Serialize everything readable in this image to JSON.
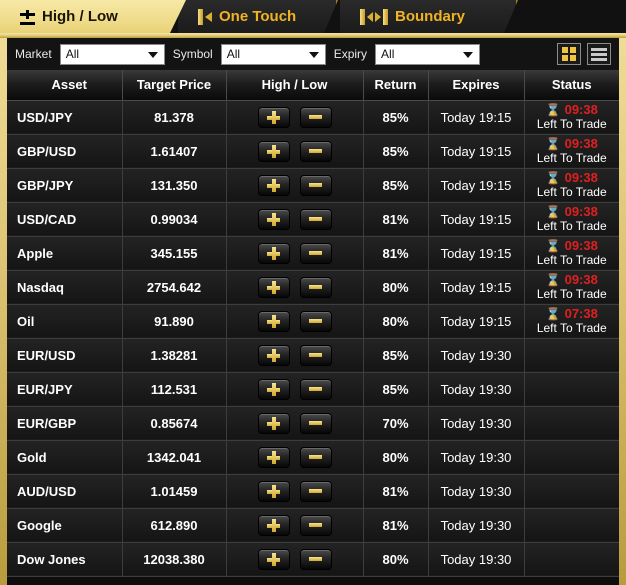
{
  "tabs": [
    {
      "label": "High / Low",
      "icon": "plus-minus-icon",
      "active": true
    },
    {
      "label": "One Touch",
      "icon": "one-touch-icon",
      "active": false
    },
    {
      "label": "Boundary",
      "icon": "boundary-icon",
      "active": false
    }
  ],
  "toolbar": {
    "market_label": "Market",
    "market_value": "All",
    "symbol_label": "Symbol",
    "symbol_value": "All",
    "expiry_label": "Expiry",
    "expiry_value": "All",
    "grid_view_icon": "grid-view-icon",
    "list_view_icon": "list-view-icon"
  },
  "table": {
    "columns": [
      "Asset",
      "Target Price",
      "High / Low",
      "Return",
      "Expires",
      "Status"
    ],
    "call_button_label": "+",
    "put_button_label": "-",
    "status_sub_label": "Left To Trade",
    "hourglass_glyph": "⌛",
    "rows": [
      {
        "asset": "USD/JPY",
        "price": "81.378",
        "return": "85%",
        "expires": "Today 19:15",
        "status_time": "09:38",
        "has_status": true
      },
      {
        "asset": "GBP/USD",
        "price": "1.61407",
        "return": "85%",
        "expires": "Today 19:15",
        "status_time": "09:38",
        "has_status": true
      },
      {
        "asset": "GBP/JPY",
        "price": "131.350",
        "return": "85%",
        "expires": "Today 19:15",
        "status_time": "09:38",
        "has_status": true
      },
      {
        "asset": "USD/CAD",
        "price": "0.99034",
        "return": "81%",
        "expires": "Today 19:15",
        "status_time": "09:38",
        "has_status": true
      },
      {
        "asset": "Apple",
        "price": "345.155",
        "return": "81%",
        "expires": "Today 19:15",
        "status_time": "09:38",
        "has_status": true
      },
      {
        "asset": "Nasdaq",
        "price": "2754.642",
        "return": "80%",
        "expires": "Today 19:15",
        "status_time": "09:38",
        "has_status": true
      },
      {
        "asset": "Oil",
        "price": "91.890",
        "return": "80%",
        "expires": "Today 19:15",
        "status_time": "07:38",
        "has_status": true
      },
      {
        "asset": "EUR/USD",
        "price": "1.38281",
        "return": "85%",
        "expires": "Today 19:30",
        "status_time": "",
        "has_status": false
      },
      {
        "asset": "EUR/JPY",
        "price": "112.531",
        "return": "85%",
        "expires": "Today 19:30",
        "status_time": "",
        "has_status": false
      },
      {
        "asset": "EUR/GBP",
        "price": "0.85674",
        "return": "70%",
        "expires": "Today 19:30",
        "status_time": "",
        "has_status": false
      },
      {
        "asset": "Gold",
        "price": "1342.041",
        "return": "80%",
        "expires": "Today 19:30",
        "status_time": "",
        "has_status": false
      },
      {
        "asset": "AUD/USD",
        "price": "1.01459",
        "return": "81%",
        "expires": "Today 19:30",
        "status_time": "",
        "has_status": false
      },
      {
        "asset": "Google",
        "price": "612.890",
        "return": "81%",
        "expires": "Today 19:30",
        "status_time": "",
        "has_status": false
      },
      {
        "asset": "Dow Jones",
        "price": "12038.380",
        "return": "80%",
        "expires": "Today 19:30",
        "status_time": "",
        "has_status": false
      }
    ]
  },
  "colors": {
    "gold": "#e8d277",
    "tab_text_gold": "#f0b323",
    "status_red": "#e02020",
    "background": "#0d0d0d"
  }
}
